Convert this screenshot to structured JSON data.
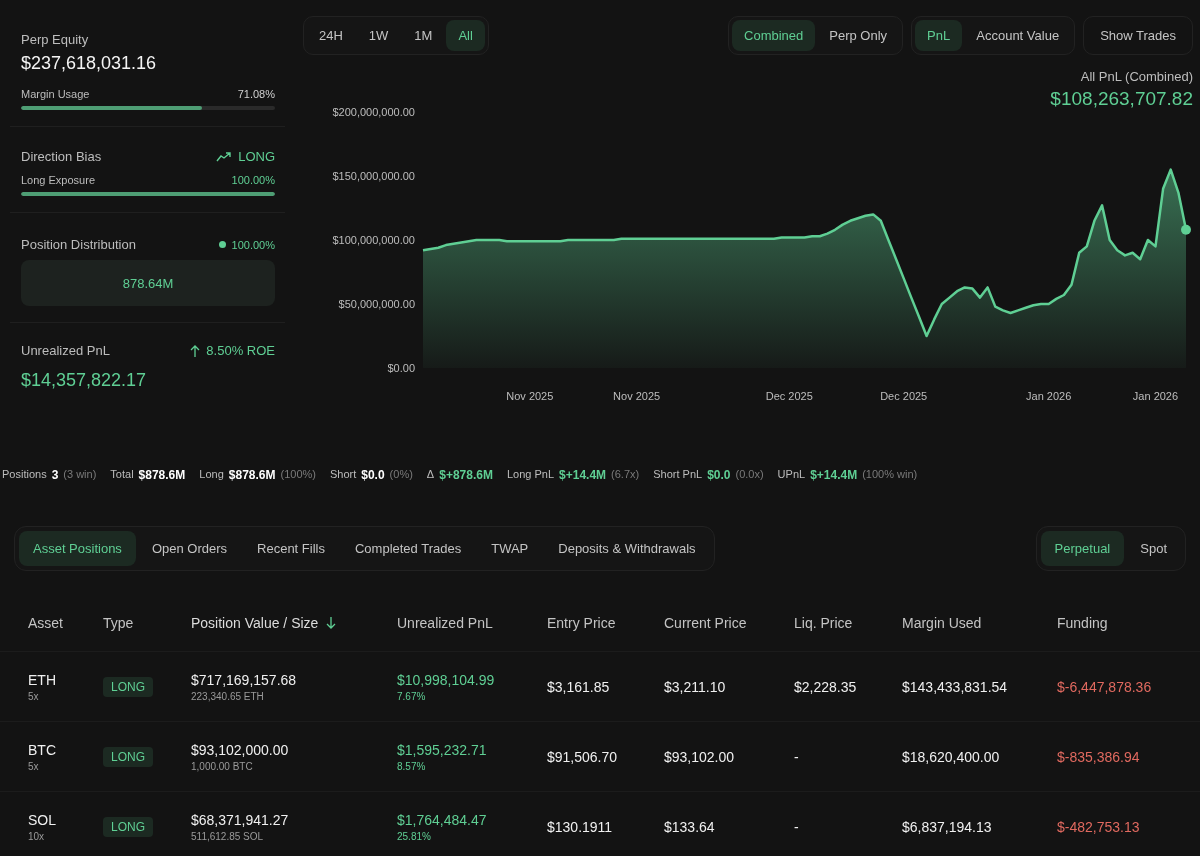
{
  "overview": {
    "perp_equity": {
      "label": "Perp Equity",
      "value": "$237,618,031.16"
    },
    "margin_usage": {
      "label": "Margin Usage",
      "reading": "71.08%",
      "level": 0.7108
    },
    "direction_bias": {
      "label": "Direction Bias",
      "value": "LONG"
    },
    "long_exposure": {
      "label": "Long Exposure",
      "reading": "100.00%",
      "level": 1.0
    },
    "position_distribution": {
      "label": "Position Distribution",
      "reading": "100.00%",
      "color": "#5fcf94",
      "bar_value": "878.64M"
    },
    "unrealized_pnl": {
      "label": "Unrealized PnL",
      "roe": "8.50% ROE",
      "value": "$14,357,822.17"
    }
  },
  "range_tabs": [
    {
      "label": "24H",
      "selected": false
    },
    {
      "label": "1W",
      "selected": false
    },
    {
      "label": "1M",
      "selected": false
    },
    {
      "label": "All",
      "selected": true
    }
  ],
  "scope_toggle": [
    {
      "label": "Combined",
      "selected": true
    },
    {
      "label": "Perp Only",
      "selected": false
    }
  ],
  "metric_toggle": [
    {
      "label": "PnL",
      "selected": true
    },
    {
      "label": "Account Value",
      "selected": false
    }
  ],
  "show_trades_button": "Show Trades",
  "chart_header": {
    "label": "All PnL (Combined)",
    "value": "$108,263,707.82"
  },
  "chart_data": {
    "type": "area",
    "ylim": [
      0,
      200000000
    ],
    "yticks": [
      {
        "value": 0,
        "label": "$0.00"
      },
      {
        "value": 50000000,
        "label": "$50,000,000.00"
      },
      {
        "value": 100000000,
        "label": "$100,000,000.00"
      },
      {
        "value": 150000000,
        "label": "$150,000,000.00"
      },
      {
        "value": 200000000,
        "label": "$200,000,000.00"
      }
    ],
    "categories": [
      null,
      null,
      null,
      null,
      null,
      null,
      null,
      null,
      null,
      null,
      null,
      null,
      null,
      null,
      "Nov 2025",
      null,
      null,
      null,
      null,
      null,
      null,
      null,
      null,
      null,
      null,
      null,
      null,
      null,
      "Nov 2025",
      null,
      null,
      null,
      null,
      null,
      null,
      null,
      null,
      null,
      null,
      null,
      null,
      null,
      null,
      null,
      null,
      null,
      null,
      null,
      "Dec 2025",
      null,
      null,
      null,
      null,
      null,
      null,
      null,
      null,
      null,
      null,
      null,
      null,
      null,
      null,
      "Dec 2025",
      null,
      null,
      null,
      null,
      null,
      null,
      null,
      null,
      null,
      null,
      null,
      null,
      null,
      null,
      null,
      null,
      null,
      null,
      "Jan 2026",
      null,
      null,
      null,
      null,
      null,
      null,
      null,
      null,
      null,
      null,
      null,
      null,
      null,
      "Jan 2026",
      null,
      null,
      null,
      null
    ],
    "series": [
      {
        "color": "#5fcf94",
        "values": [
          92000000,
          93000000,
          94000000,
          96000000,
          97000000,
          98000000,
          99000000,
          100000000,
          100000000,
          100000000,
          100000000,
          99000000,
          99000000,
          99000000,
          99000000,
          99000000,
          99000000,
          99000000,
          99000000,
          100000000,
          100000000,
          100000000,
          100000000,
          100000000,
          100000000,
          100000000,
          101000000,
          101000000,
          101000000,
          101000000,
          101000000,
          101000000,
          101000000,
          101000000,
          101000000,
          101000000,
          101000000,
          101000000,
          101000000,
          101000000,
          101000000,
          101000000,
          101000000,
          101000000,
          101000000,
          101000000,
          101000000,
          102000000,
          102000000,
          102000000,
          102000000,
          103000000,
          103000000,
          105000000,
          108000000,
          112000000,
          115000000,
          117000000,
          119000000,
          120000000,
          115000000,
          100000000,
          85000000,
          70000000,
          55000000,
          40000000,
          25000000,
          38000000,
          50000000,
          55000000,
          60000000,
          63000000,
          62000000,
          55000000,
          63000000,
          48000000,
          45000000,
          43000000,
          45000000,
          47000000,
          49000000,
          50000000,
          50000000,
          54000000,
          57000000,
          65000000,
          90000000,
          95000000,
          115000000,
          127000000,
          100000000,
          92000000,
          88000000,
          90000000,
          85000000,
          100000000,
          95000000,
          140000000,
          155000000,
          137000000,
          108000000
        ]
      }
    ]
  },
  "stats_bar": [
    {
      "label": "Positions",
      "value": "3",
      "note": "(3 win)",
      "color": "#ffffff"
    },
    {
      "label": "Total",
      "value": "$878.6M",
      "color": "#ffffff"
    },
    {
      "label": "Long",
      "value": "$878.6M",
      "note": "(100%)",
      "color": "#ffffff"
    },
    {
      "label": "Short",
      "value": "$0.0",
      "note": "(0%)",
      "color": "#ffffff"
    },
    {
      "label": "Δ",
      "value": "$+878.6M",
      "color": "#5fcf94"
    },
    {
      "label": "Long PnL",
      "value": "$+14.4M",
      "note": "(6.7x)",
      "color": "#5fcf94"
    },
    {
      "label": "Short PnL",
      "value": "$0.0",
      "note": "(0.0x)",
      "color": "#5fcf94"
    },
    {
      "label": "UPnL",
      "value": "$+14.4M",
      "note": "(100% win)",
      "color": "#5fcf94"
    }
  ],
  "tabs": [
    {
      "label": "Asset Positions",
      "selected": true
    },
    {
      "label": "Open Orders",
      "selected": false
    },
    {
      "label": "Recent Fills",
      "selected": false
    },
    {
      "label": "Completed Trades",
      "selected": false
    },
    {
      "label": "TWAP",
      "selected": false
    },
    {
      "label": "Deposits & Withdrawals",
      "selected": false
    }
  ],
  "market_toggle": [
    {
      "label": "Perpetual",
      "selected": true
    },
    {
      "label": "Spot",
      "selected": false
    }
  ],
  "table": {
    "columns": [
      {
        "label": "Asset",
        "sorted": false
      },
      {
        "label": "Type",
        "sorted": false
      },
      {
        "label": "Position Value / Size",
        "sorted": true
      },
      {
        "label": "Unrealized PnL",
        "sorted": false
      },
      {
        "label": "Entry Price",
        "sorted": false
      },
      {
        "label": "Current Price",
        "sorted": false
      },
      {
        "label": "Liq. Price",
        "sorted": false
      },
      {
        "label": "Margin Used",
        "sorted": false
      },
      {
        "label": "Funding",
        "sorted": false
      }
    ],
    "rows": [
      {
        "asset": "ETH",
        "leverage": "5x",
        "type": "LONG",
        "value": "$717,169,157.68",
        "size": "223,340.65 ETH",
        "upnl": "$10,998,104.99",
        "upnl_pct": "7.67%",
        "entry": "$3,161.85",
        "current": "$3,211.10",
        "liq": "$2,228.35",
        "margin": "$143,433,831.54",
        "funding": "$-6,447,878.36"
      },
      {
        "asset": "BTC",
        "leverage": "5x",
        "type": "LONG",
        "value": "$93,102,000.00",
        "size": "1,000.00 BTC",
        "upnl": "$1,595,232.71",
        "upnl_pct": "8.57%",
        "entry": "$91,506.70",
        "current": "$93,102.00",
        "liq": "-",
        "margin": "$18,620,400.00",
        "funding": "$-835,386.94"
      },
      {
        "asset": "SOL",
        "leverage": "10x",
        "type": "LONG",
        "value": "$68,371,941.27",
        "size": "511,612.85 SOL",
        "upnl": "$1,764,484.47",
        "upnl_pct": "25.81%",
        "entry": "$130.1911",
        "current": "$133.64",
        "liq": "-",
        "margin": "$6,837,194.13",
        "funding": "$-482,753.13"
      }
    ]
  }
}
